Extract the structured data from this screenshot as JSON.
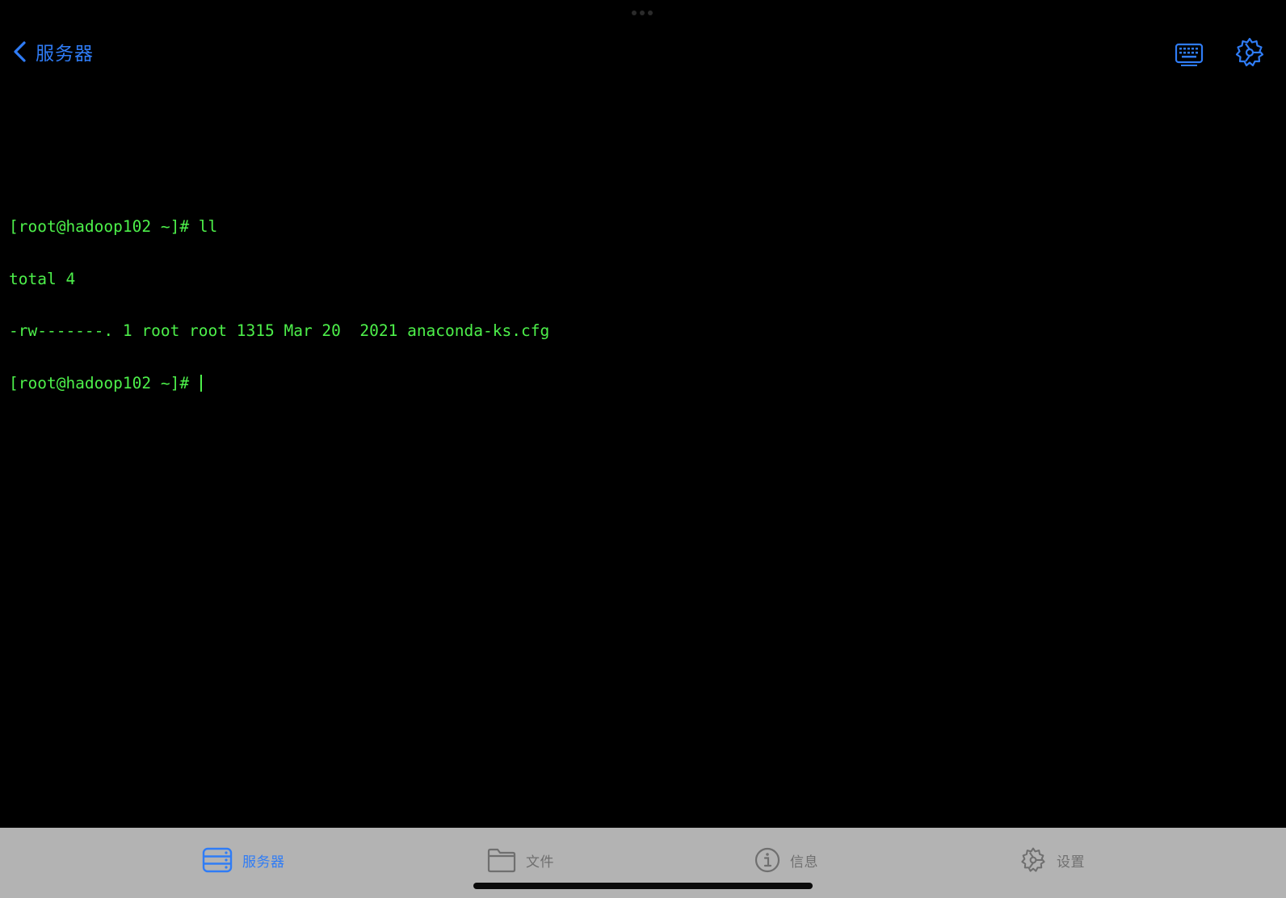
{
  "nav": {
    "back_label": "服务器",
    "accent_color": "#2f7cf6"
  },
  "icons": {
    "back": "chevron-left-icon",
    "keyboard": "keyboard-icon",
    "settings": "gear-icon"
  },
  "terminal": {
    "text_color": "#4df04a",
    "lines": [
      "[root@hadoop102 ~]# ll",
      "total 4",
      "-rw-------. 1 root root 1315 Mar 20  2021 anaconda-ks.cfg",
      "[root@hadoop102 ~]# "
    ]
  },
  "tabbar": {
    "tabs": [
      {
        "label": "服务器",
        "icon": "server-icon",
        "active": true
      },
      {
        "label": "文件",
        "icon": "folder-icon",
        "active": false
      },
      {
        "label": "信息",
        "icon": "info-icon",
        "active": false
      },
      {
        "label": "设置",
        "icon": "gear-icon",
        "active": false
      }
    ]
  }
}
